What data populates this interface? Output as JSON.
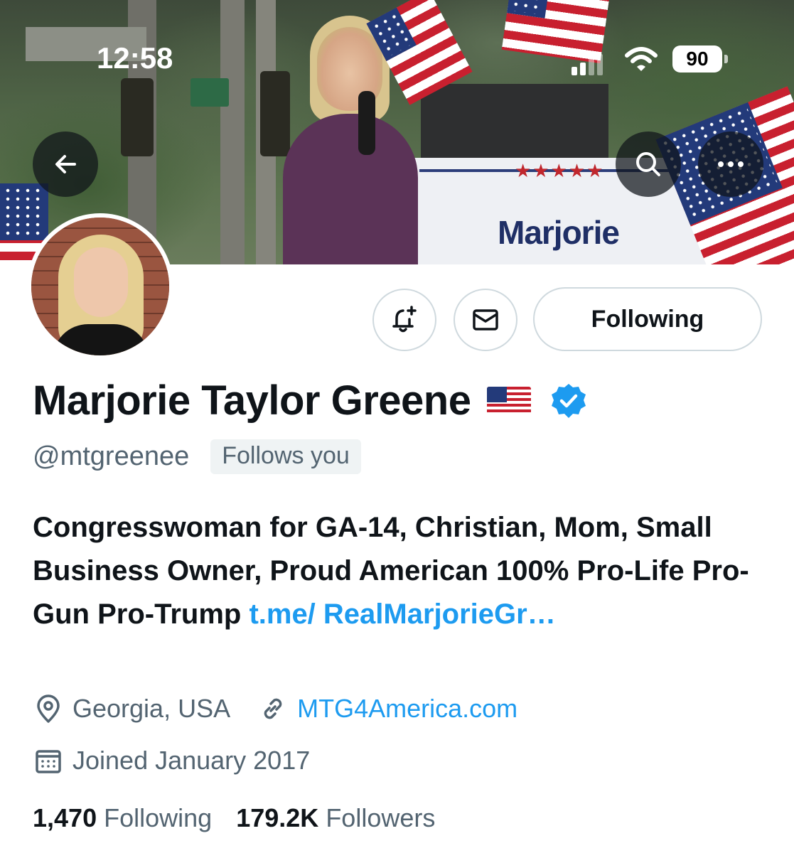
{
  "status_bar": {
    "time": "12:58",
    "battery": "90"
  },
  "header": {
    "back_icon": "arrow-left-icon",
    "search_icon": "search-icon",
    "more_icon": "more-horizontal-icon",
    "banner_sign_text": "Marjorie"
  },
  "actions": {
    "notify_icon": "bell-plus-icon",
    "message_icon": "envelope-icon",
    "following_label": "Following"
  },
  "profile": {
    "name": "Marjorie Taylor Greene",
    "name_emoji": "us-flag-emoji",
    "verified": true,
    "handle": "@mtgreenee",
    "follows_you": "Follows you",
    "bio_text": "Congresswoman for GA-14, Christian, Mom, Small Business Owner, Proud American 100% Pro-Life Pro-Gun Pro-Trump ",
    "bio_link": "t.me/ RealMarjorieGr…",
    "location": "Georgia, USA",
    "website": "MTG4America.com",
    "joined": "Joined January 2017",
    "following_count": "1,470",
    "following_label": "Following",
    "followers_count": "179.2K",
    "followers_label": "Followers"
  },
  "colors": {
    "accent": "#1d9bf0",
    "text_primary": "#0f1419",
    "text_secondary": "#536471",
    "border": "#cfd9de"
  }
}
